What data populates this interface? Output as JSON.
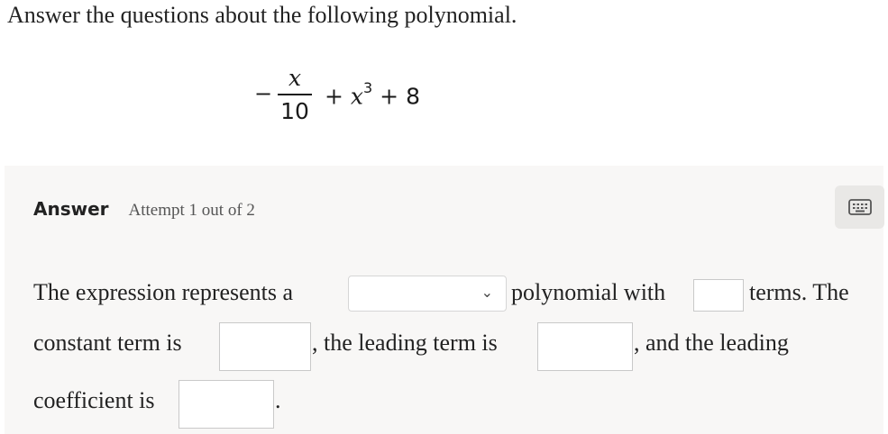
{
  "header": {
    "instruction": "Answer the questions about the following polynomial."
  },
  "expression": {
    "minus": "−",
    "numerator": "x",
    "denominator": "10",
    "plus1": "+",
    "var": "x",
    "exponent": "3",
    "plus2": "+",
    "constant": "8"
  },
  "answer": {
    "label": "Answer",
    "attempt": "Attempt 1 out of 2",
    "keyboard_icon": "keyboard-icon"
  },
  "question": {
    "p1": "The expression represents a",
    "p2": "polynomial with",
    "p3": "terms. The",
    "p4": "constant term is",
    "p5": ", the leading term is",
    "p6": ", and the leading",
    "p7": "coefficient is",
    "p8": ".",
    "dropdown_value": "",
    "chevron": "⌄"
  },
  "fields": {
    "terms": "",
    "constant_term": "",
    "leading_term": "",
    "leading_coefficient": ""
  }
}
